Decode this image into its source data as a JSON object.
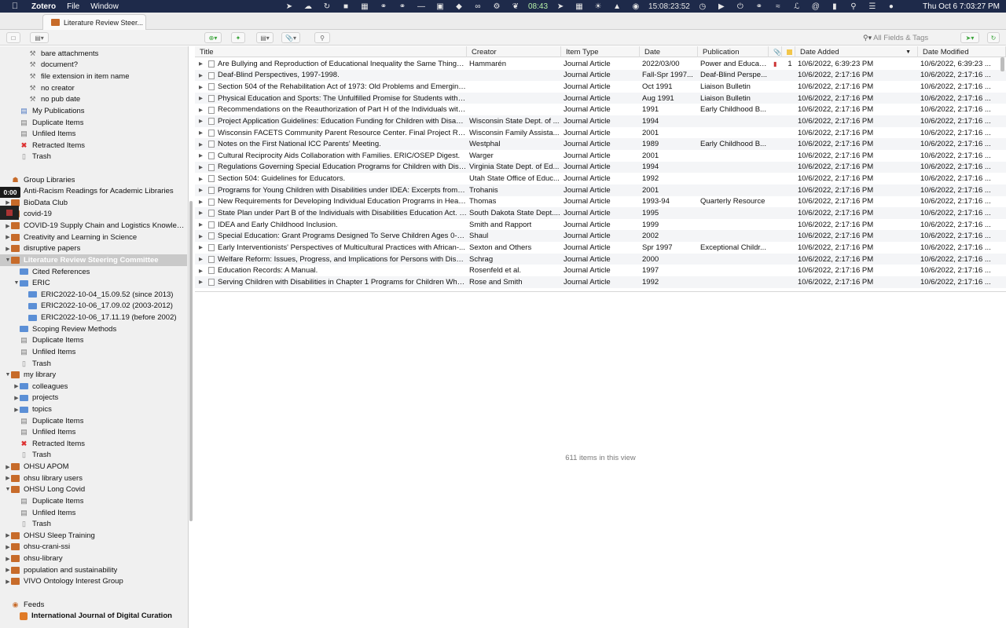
{
  "menubar": {
    "app_name": "Zotero",
    "menus": [
      "File",
      "Window"
    ],
    "status_time_green": "08:43",
    "status_timer": "15:08:23:52",
    "datetime": "Thu Oct 6  7:03:27 PM"
  },
  "tab": {
    "label": "Literature Review Steer..."
  },
  "search": {
    "placeholder": "All Fields & Tags"
  },
  "sidebar": {
    "timer": "0:00",
    "items": [
      {
        "label": "bare attachments",
        "icon": "saved-search",
        "indent": 2
      },
      {
        "label": "document?",
        "icon": "saved-search",
        "indent": 2
      },
      {
        "label": "file extension in item name",
        "icon": "saved-search",
        "indent": 2
      },
      {
        "label": "no creator",
        "icon": "saved-search",
        "indent": 2
      },
      {
        "label": "no pub date",
        "icon": "saved-search",
        "indent": 2
      },
      {
        "label": "My Publications",
        "icon": "publications",
        "indent": 1
      },
      {
        "label": "Duplicate Items",
        "icon": "duplicate",
        "indent": 1
      },
      {
        "label": "Unfiled Items",
        "icon": "unfiled",
        "indent": 1
      },
      {
        "label": "Retracted Items",
        "icon": "retracted",
        "indent": 1
      },
      {
        "label": "Trash",
        "icon": "trash",
        "indent": 1
      },
      {
        "label": "",
        "icon": "none",
        "indent": 0
      },
      {
        "label": "Group Libraries",
        "icon": "group",
        "indent": 0
      },
      {
        "label": "Anti-Racism Readings for Academic Libraries",
        "icon": "library",
        "indent": 0,
        "twisty": "closed"
      },
      {
        "label": "BioData Club",
        "icon": "library",
        "indent": 0,
        "twisty": "closed"
      },
      {
        "label": "covid-19",
        "icon": "library",
        "indent": 0,
        "twisty": "closed"
      },
      {
        "label": "COVID-19 Supply Chain and Logistics Knowled...",
        "icon": "library",
        "indent": 0,
        "twisty": "closed"
      },
      {
        "label": "Creativity and Learning in Science",
        "icon": "library",
        "indent": 0,
        "twisty": "closed"
      },
      {
        "label": "disruptive papers",
        "icon": "library",
        "indent": 0,
        "twisty": "closed"
      },
      {
        "label": "Literature Review Steering Committee",
        "icon": "library",
        "indent": 0,
        "twisty": "open",
        "selected": true
      },
      {
        "label": "Cited References",
        "icon": "folder",
        "indent": 1
      },
      {
        "label": "ERIC",
        "icon": "folder",
        "indent": 1,
        "twisty": "open"
      },
      {
        "label": "ERIC2022-10-04_15.09.52 (since 2013)",
        "icon": "folder",
        "indent": 2
      },
      {
        "label": "ERIC2022-10-06_17.09.02 (2003-2012)",
        "icon": "folder",
        "indent": 2
      },
      {
        "label": "ERIC2022-10-06_17.11.19 (before 2002)",
        "icon": "folder",
        "indent": 2
      },
      {
        "label": "Scoping Review Methods",
        "icon": "folder",
        "indent": 1
      },
      {
        "label": "Duplicate Items",
        "icon": "duplicate",
        "indent": 1
      },
      {
        "label": "Unfiled Items",
        "icon": "unfiled",
        "indent": 1
      },
      {
        "label": "Trash",
        "icon": "trash",
        "indent": 1
      },
      {
        "label": "my library",
        "icon": "library",
        "indent": 0,
        "twisty": "open"
      },
      {
        "label": "colleagues",
        "icon": "folder",
        "indent": 1,
        "twisty": "closed"
      },
      {
        "label": "projects",
        "icon": "folder",
        "indent": 1,
        "twisty": "closed"
      },
      {
        "label": "topics",
        "icon": "folder",
        "indent": 1,
        "twisty": "closed"
      },
      {
        "label": "Duplicate Items",
        "icon": "duplicate",
        "indent": 1
      },
      {
        "label": "Unfiled Items",
        "icon": "unfiled",
        "indent": 1
      },
      {
        "label": "Retracted Items",
        "icon": "retracted",
        "indent": 1
      },
      {
        "label": "Trash",
        "icon": "trash",
        "indent": 1
      },
      {
        "label": "OHSU APOM",
        "icon": "library",
        "indent": 0,
        "twisty": "closed"
      },
      {
        "label": "ohsu library users",
        "icon": "library",
        "indent": 0,
        "twisty": "closed"
      },
      {
        "label": "OHSU Long Covid",
        "icon": "library",
        "indent": 0,
        "twisty": "open"
      },
      {
        "label": "Duplicate Items",
        "icon": "duplicate",
        "indent": 1
      },
      {
        "label": "Unfiled Items",
        "icon": "unfiled",
        "indent": 1
      },
      {
        "label": "Trash",
        "icon": "trash",
        "indent": 1
      },
      {
        "label": "OHSU Sleep Training",
        "icon": "library",
        "indent": 0,
        "twisty": "closed"
      },
      {
        "label": "ohsu-crani-ssi",
        "icon": "library",
        "indent": 0,
        "twisty": "closed"
      },
      {
        "label": "ohsu-library",
        "icon": "library",
        "indent": 0,
        "twisty": "closed"
      },
      {
        "label": "population and sustainability",
        "icon": "library",
        "indent": 0,
        "twisty": "closed"
      },
      {
        "label": "VIVO Ontology Interest Group",
        "icon": "library",
        "indent": 0,
        "twisty": "closed"
      },
      {
        "label": "",
        "icon": "none",
        "indent": 0
      },
      {
        "label": "Feeds",
        "icon": "feeds",
        "indent": 0
      },
      {
        "label": "International Journal of Digital Curation",
        "icon": "feed",
        "indent": 1,
        "bold": true
      }
    ]
  },
  "table": {
    "columns": [
      "Title",
      "Creator",
      "Item Type",
      "Date",
      "Publication",
      "",
      "",
      "Date Added",
      "Date Modified"
    ],
    "rows": [
      {
        "title": "Are Bullying and Reproduction of Educational Inequality the Same Thing? ...",
        "creator": "Hammarén",
        "type": "Journal Article",
        "date": "2022/03/00",
        "pub": "Power and Educati...",
        "attach": "pdf",
        "notes": "1",
        "added": "10/6/2022, 6:39:23 PM",
        "modified": "10/6/2022, 6:39:23 ..."
      },
      {
        "title": "Deaf-Blind Perspectives, 1997-1998.",
        "creator": "",
        "type": "Journal Article",
        "date": "Fall-Spr 1997...",
        "pub": "Deaf-Blind Perspe...",
        "attach": "",
        "notes": "",
        "added": "10/6/2022, 2:17:16 PM",
        "modified": "10/6/2022, 2:17:16 ..."
      },
      {
        "title": "Section 504 of the Rehabilitation Act of 1973: Old Problems and Emerging...",
        "creator": "",
        "type": "Journal Article",
        "date": "Oct 1991",
        "pub": "Liaison Bulletin",
        "attach": "",
        "notes": "",
        "added": "10/6/2022, 2:17:16 PM",
        "modified": "10/6/2022, 2:17:16 ..."
      },
      {
        "title": "Physical Education and Sports: The Unfulfilled Promise for Students with D...",
        "creator": "",
        "type": "Journal Article",
        "date": "Aug 1991",
        "pub": "Liaison Bulletin",
        "attach": "",
        "notes": "",
        "added": "10/6/2022, 2:17:16 PM",
        "modified": "10/6/2022, 2:17:16 ..."
      },
      {
        "title": "Recommendations on the Reauthorization of Part H of the Individuals with...",
        "creator": "",
        "type": "Journal Article",
        "date": "1991",
        "pub": "Early Childhood B...",
        "attach": "",
        "notes": "",
        "added": "10/6/2022, 2:17:16 PM",
        "modified": "10/6/2022, 2:17:16 ..."
      },
      {
        "title": "Project Application Guidelines: Education Funding for Children with Disabi...",
        "creator": "Wisconsin State Dept. of ...",
        "type": "Journal Article",
        "date": "1994",
        "pub": "",
        "attach": "",
        "notes": "",
        "added": "10/6/2022, 2:17:16 PM",
        "modified": "10/6/2022, 2:17:16 ..."
      },
      {
        "title": "Wisconsin FACETS Community Parent Resource Center. Final Project Repor...",
        "creator": "Wisconsin Family Assista...",
        "type": "Journal Article",
        "date": "2001",
        "pub": "",
        "attach": "",
        "notes": "",
        "added": "10/6/2022, 2:17:16 PM",
        "modified": "10/6/2022, 2:17:16 ..."
      },
      {
        "title": "Notes on the First National ICC Parents' Meeting.",
        "creator": "Westphal",
        "type": "Journal Article",
        "date": "1989",
        "pub": "Early Childhood B...",
        "attach": "",
        "notes": "",
        "added": "10/6/2022, 2:17:16 PM",
        "modified": "10/6/2022, 2:17:16 ..."
      },
      {
        "title": "Cultural Reciprocity Aids Collaboration with Families. ERIC/OSEP Digest.",
        "creator": "Warger",
        "type": "Journal Article",
        "date": "2001",
        "pub": "",
        "attach": "",
        "notes": "",
        "added": "10/6/2022, 2:17:16 PM",
        "modified": "10/6/2022, 2:17:16 ..."
      },
      {
        "title": "Regulations Governing Special Education Programs for Children with Disa...",
        "creator": "Virginia State Dept. of Ed...",
        "type": "Journal Article",
        "date": "1994",
        "pub": "",
        "attach": "",
        "notes": "",
        "added": "10/6/2022, 2:17:16 PM",
        "modified": "10/6/2022, 2:17:16 ..."
      },
      {
        "title": "Section 504: Guidelines for Educators.",
        "creator": "Utah State Office of Educ...",
        "type": "Journal Article",
        "date": "1992",
        "pub": "",
        "attach": "",
        "notes": "",
        "added": "10/6/2022, 2:17:16 PM",
        "modified": "10/6/2022, 2:17:16 ..."
      },
      {
        "title": "Programs for Young Children with Disabilities under IDEA: Excerpts from t...",
        "creator": "Trohanis",
        "type": "Journal Article",
        "date": "2001",
        "pub": "",
        "attach": "",
        "notes": "",
        "added": "10/6/2022, 2:17:16 PM",
        "modified": "10/6/2022, 2:17:16 ..."
      },
      {
        "title": "New Requirements for Developing Individual Education Programs in Head ...",
        "creator": "Thomas",
        "type": "Journal Article",
        "date": "1993-94",
        "pub": "Quarterly Resource",
        "attach": "",
        "notes": "",
        "added": "10/6/2022, 2:17:16 PM",
        "modified": "10/6/2022, 2:17:16 ..."
      },
      {
        "title": "State Plan under Part B of the Individuals with Disabilities Education Act. F...",
        "creator": "South Dakota State Dept....",
        "type": "Journal Article",
        "date": "1995",
        "pub": "",
        "attach": "",
        "notes": "",
        "added": "10/6/2022, 2:17:16 PM",
        "modified": "10/6/2022, 2:17:16 ..."
      },
      {
        "title": "IDEA and Early Childhood Inclusion.",
        "creator": "Smith and Rapport",
        "type": "Journal Article",
        "date": "1999",
        "pub": "",
        "attach": "",
        "notes": "",
        "added": "10/6/2022, 2:17:16 PM",
        "modified": "10/6/2022, 2:17:16 ..."
      },
      {
        "title": "Special Education: Grant Programs Designed To Serve Children Ages 0-5. ...",
        "creator": "Shaul",
        "type": "Journal Article",
        "date": "2002",
        "pub": "",
        "attach": "",
        "notes": "",
        "added": "10/6/2022, 2:17:16 PM",
        "modified": "10/6/2022, 2:17:16 ..."
      },
      {
        "title": "Early Interventionists' Perspectives of Multicultural Practices with African-...",
        "creator": "Sexton and Others",
        "type": "Journal Article",
        "date": "Spr 1997",
        "pub": "Exceptional Childr...",
        "attach": "",
        "notes": "",
        "added": "10/6/2022, 2:17:16 PM",
        "modified": "10/6/2022, 2:17:16 ..."
      },
      {
        "title": "Welfare Reform: Issues, Progress, and Implications for Persons with Disabi...",
        "creator": "Schrag",
        "type": "Journal Article",
        "date": "2000",
        "pub": "",
        "attach": "",
        "notes": "",
        "added": "10/6/2022, 2:17:16 PM",
        "modified": "10/6/2022, 2:17:16 ..."
      },
      {
        "title": "Education Records: A Manual.",
        "creator": "Rosenfeld et al.",
        "type": "Journal Article",
        "date": "1997",
        "pub": "",
        "attach": "",
        "notes": "",
        "added": "10/6/2022, 2:17:16 PM",
        "modified": "10/6/2022, 2:17:16 ..."
      },
      {
        "title": "Serving Children with Disabilities in Chapter 1 Programs for Children Who ...",
        "creator": "Rose and Smith",
        "type": "Journal Article",
        "date": "1992",
        "pub": "",
        "attach": "",
        "notes": "",
        "added": "10/6/2022, 2:17:16 PM",
        "modified": "10/6/2022, 2:17:16 ..."
      }
    ]
  },
  "pane": {
    "count_text": "611 items in this view"
  },
  "colors": {
    "menubar": "#1e2a4a",
    "library_icon": "#c76b2a",
    "folder_icon": "#5b8fd6",
    "retracted": "#dd3333"
  }
}
